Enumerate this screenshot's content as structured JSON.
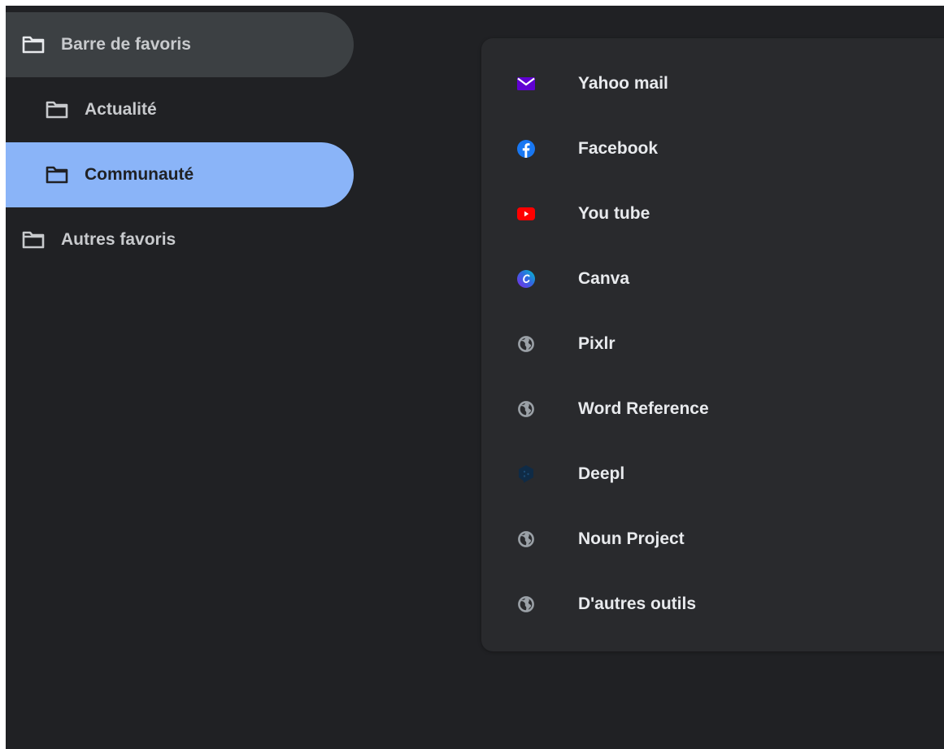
{
  "sidebar": {
    "items": [
      {
        "label": "Barre de favoris",
        "level": 0,
        "state": "open"
      },
      {
        "label": "Actualité",
        "level": 1,
        "state": "normal"
      },
      {
        "label": "Communauté",
        "level": 1,
        "state": "selected"
      },
      {
        "label": "Autres favoris",
        "level": 0,
        "state": "normal"
      }
    ]
  },
  "bookmarks": {
    "items": [
      {
        "title": "Yahoo mail",
        "icon": "yahoo-mail-icon"
      },
      {
        "title": "Facebook",
        "icon": "facebook-icon"
      },
      {
        "title": "You tube",
        "icon": "youtube-icon"
      },
      {
        "title": "Canva",
        "icon": "canva-icon"
      },
      {
        "title": "Pixlr",
        "icon": "globe-icon"
      },
      {
        "title": "Word Reference",
        "icon": "globe-icon"
      },
      {
        "title": "Deepl",
        "icon": "deepl-icon"
      },
      {
        "title": "Noun Project",
        "icon": "globe-icon"
      },
      {
        "title": "D'autres outils",
        "icon": "globe-icon"
      }
    ]
  },
  "colors": {
    "background": "#202124",
    "panel": "#292a2d",
    "selected": "#8ab4f8",
    "open_folder": "#3c4043",
    "text": "#e8eaed"
  }
}
